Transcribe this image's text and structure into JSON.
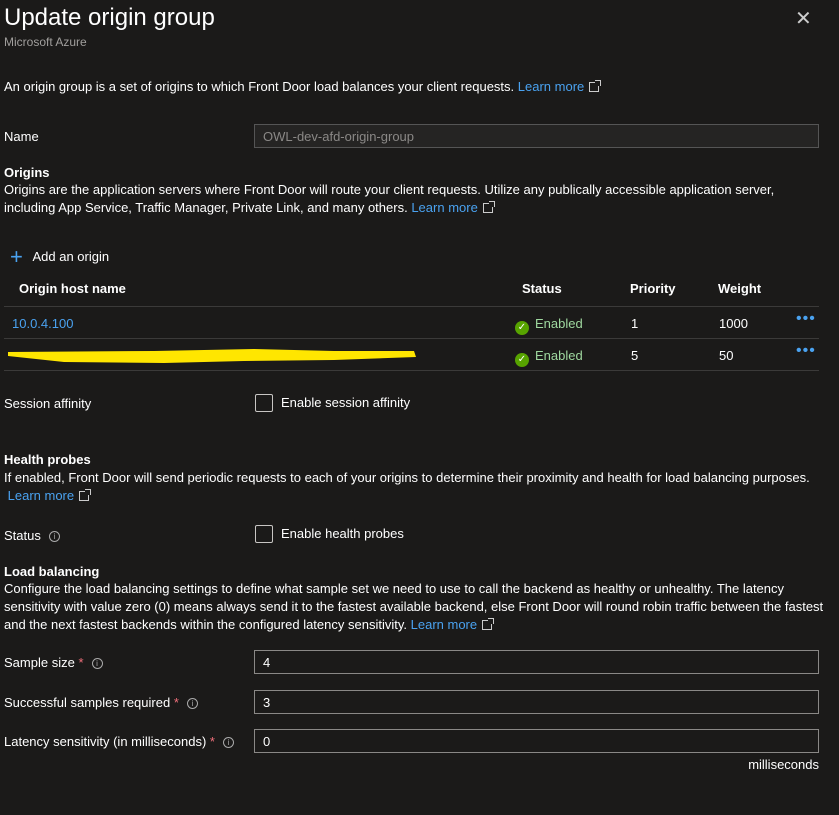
{
  "header": {
    "title": "Update origin group",
    "subtitle": "Microsoft Azure"
  },
  "intro": {
    "text": "An origin group is a set of origins to which Front Door load balances your client requests.",
    "learn_more": "Learn more"
  },
  "name": {
    "label": "Name",
    "value": "OWL-dev-afd-origin-group"
  },
  "origins": {
    "title": "Origins",
    "desc": "Origins are the application servers where Front Door will route your client requests. Utilize any publically accessible application server, including App Service, Traffic Manager, Private Link, and many others.",
    "learn_more": "Learn more",
    "add_label": "Add an origin",
    "columns": [
      "Origin host name",
      "Status",
      "Priority",
      "Weight"
    ],
    "rows": [
      {
        "host": "10.0.4.100",
        "status": "Enabled",
        "priority": "1",
        "weight": "1000"
      },
      {
        "host": "",
        "status": "Enabled",
        "priority": "5",
        "weight": "50"
      }
    ]
  },
  "session": {
    "label": "Session affinity",
    "checkbox": "Enable session affinity",
    "checked": false
  },
  "health": {
    "title": "Health probes",
    "desc": "If enabled, Front Door will send periodic requests to each of your origins to determine their proximity and health for load balancing purposes.",
    "learn_more": "Learn more",
    "status_label": "Status",
    "checkbox": "Enable health probes",
    "checked": false
  },
  "lb": {
    "title": "Load balancing",
    "desc": "Configure the load balancing settings to define what sample set we need to use to call the backend as healthy or unhealthy. The latency sensitivity with value zero (0) means always send it to the fastest available backend, else Front Door will round robin traffic between the fastest and the next fastest backends within the configured latency sensitivity.",
    "learn_more": "Learn more",
    "sample_size_label": "Sample size",
    "sample_size": "4",
    "success_label": "Successful samples required",
    "success": "3",
    "latency_label": "Latency sensitivity (in milliseconds)",
    "latency": "0",
    "unit": "milliseconds"
  },
  "colors": {
    "link": "#4aa2f0",
    "enabled": "#57a300",
    "redaction": "#ffe600"
  }
}
